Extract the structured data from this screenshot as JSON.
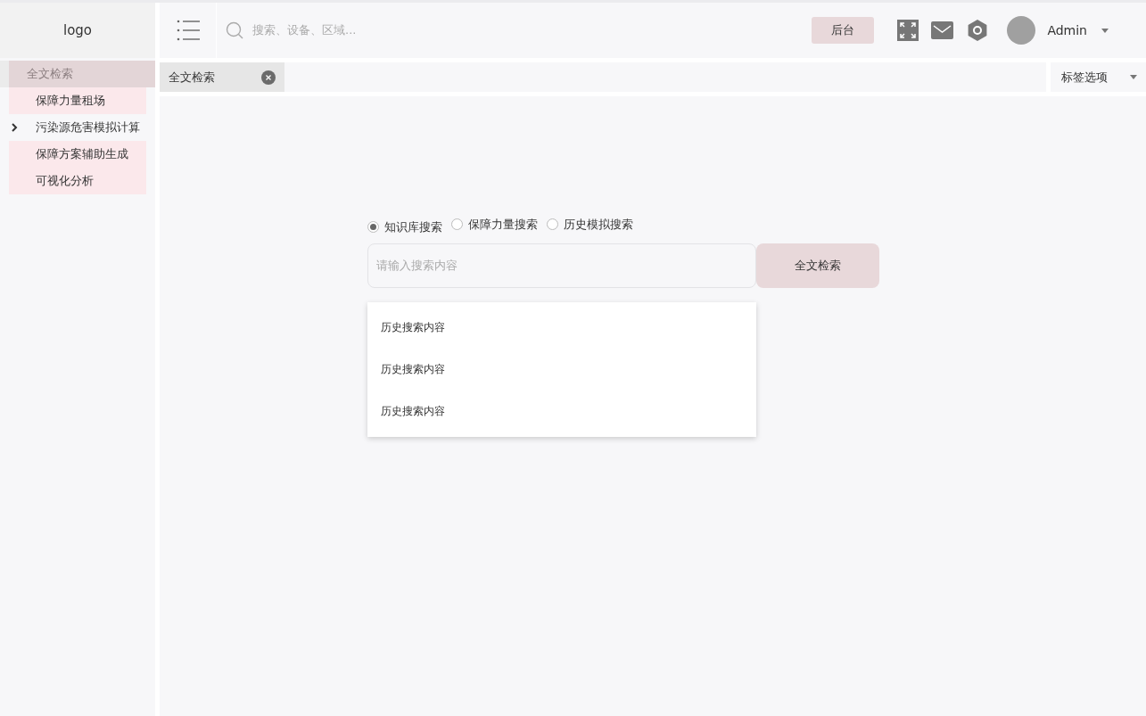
{
  "logo": "logo",
  "header": {
    "search_placeholder": "搜索、设备、区域...",
    "admin_button": "后台",
    "user": "Admin"
  },
  "sidebar": {
    "items": [
      {
        "label": "全文检索",
        "kind": "link",
        "selected": true
      },
      {
        "label": "保障力量租场",
        "kind": "link",
        "selected": false
      },
      {
        "label": "污染源危害模拟计算",
        "kind": "group",
        "selected": false,
        "expanded": false
      },
      {
        "label": "保障方案辅助生成",
        "kind": "link",
        "selected": false
      },
      {
        "label": "可视化分析",
        "kind": "link",
        "selected": false
      }
    ]
  },
  "tabs": [
    {
      "label": "全文检索",
      "selected": true
    }
  ],
  "tab_options": "标签选项",
  "search": {
    "modes": [
      {
        "label": "知识库搜索",
        "selected": true
      },
      {
        "label": "保障力量搜索",
        "selected": false
      },
      {
        "label": "历史模拟搜索",
        "selected": false
      }
    ],
    "placeholder": "请输入搜索内容",
    "button": "全文检索",
    "history": [
      "历史搜索内容",
      "历史搜索内容",
      "历史搜索内容"
    ]
  }
}
